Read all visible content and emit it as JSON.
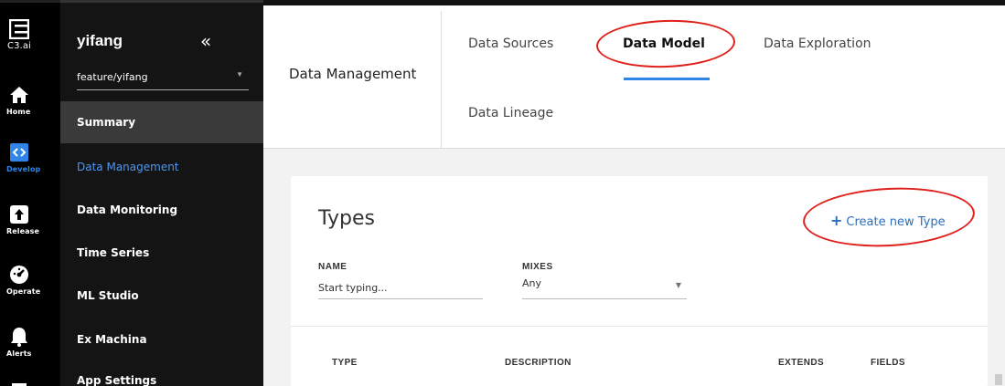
{
  "rail": {
    "logo_label": "C3.ai",
    "items": [
      {
        "icon": "home-icon",
        "label": "Home"
      },
      {
        "icon": "develop-icon",
        "label": "Develop"
      },
      {
        "icon": "release-icon",
        "label": "Release"
      },
      {
        "icon": "operate-icon",
        "label": "Operate"
      },
      {
        "icon": "alerts-icon",
        "label": "Alerts"
      }
    ]
  },
  "sidebar": {
    "title": "yifang",
    "collapse_glyph": "«",
    "branch": "feature/yifang",
    "items": [
      {
        "label": "Summary"
      },
      {
        "label": "Data Management"
      },
      {
        "label": "Data Monitoring"
      },
      {
        "label": "Time Series"
      },
      {
        "label": "ML Studio"
      },
      {
        "label": "Ex Machina"
      },
      {
        "label": "App Settings"
      }
    ]
  },
  "header": {
    "title": "Data Management",
    "tabs": [
      {
        "label": "Data Sources"
      },
      {
        "label": "Data Model"
      },
      {
        "label": "Data Exploration"
      },
      {
        "label": "Data Lineage"
      }
    ]
  },
  "card": {
    "title": "Types",
    "create_label": "Create new Type",
    "filters": {
      "name_label": "NAME",
      "name_placeholder": "Start typing...",
      "mixes_label": "MIXES",
      "mixes_value": "Any"
    },
    "columns": [
      "TYPE",
      "DESCRIPTION",
      "EXTENDS",
      "FIELDS"
    ]
  },
  "colors": {
    "accent": "#2f86e8",
    "annotation": "#e0201a",
    "rail_bg": "#000000",
    "sidebar_bg": "#141414"
  }
}
